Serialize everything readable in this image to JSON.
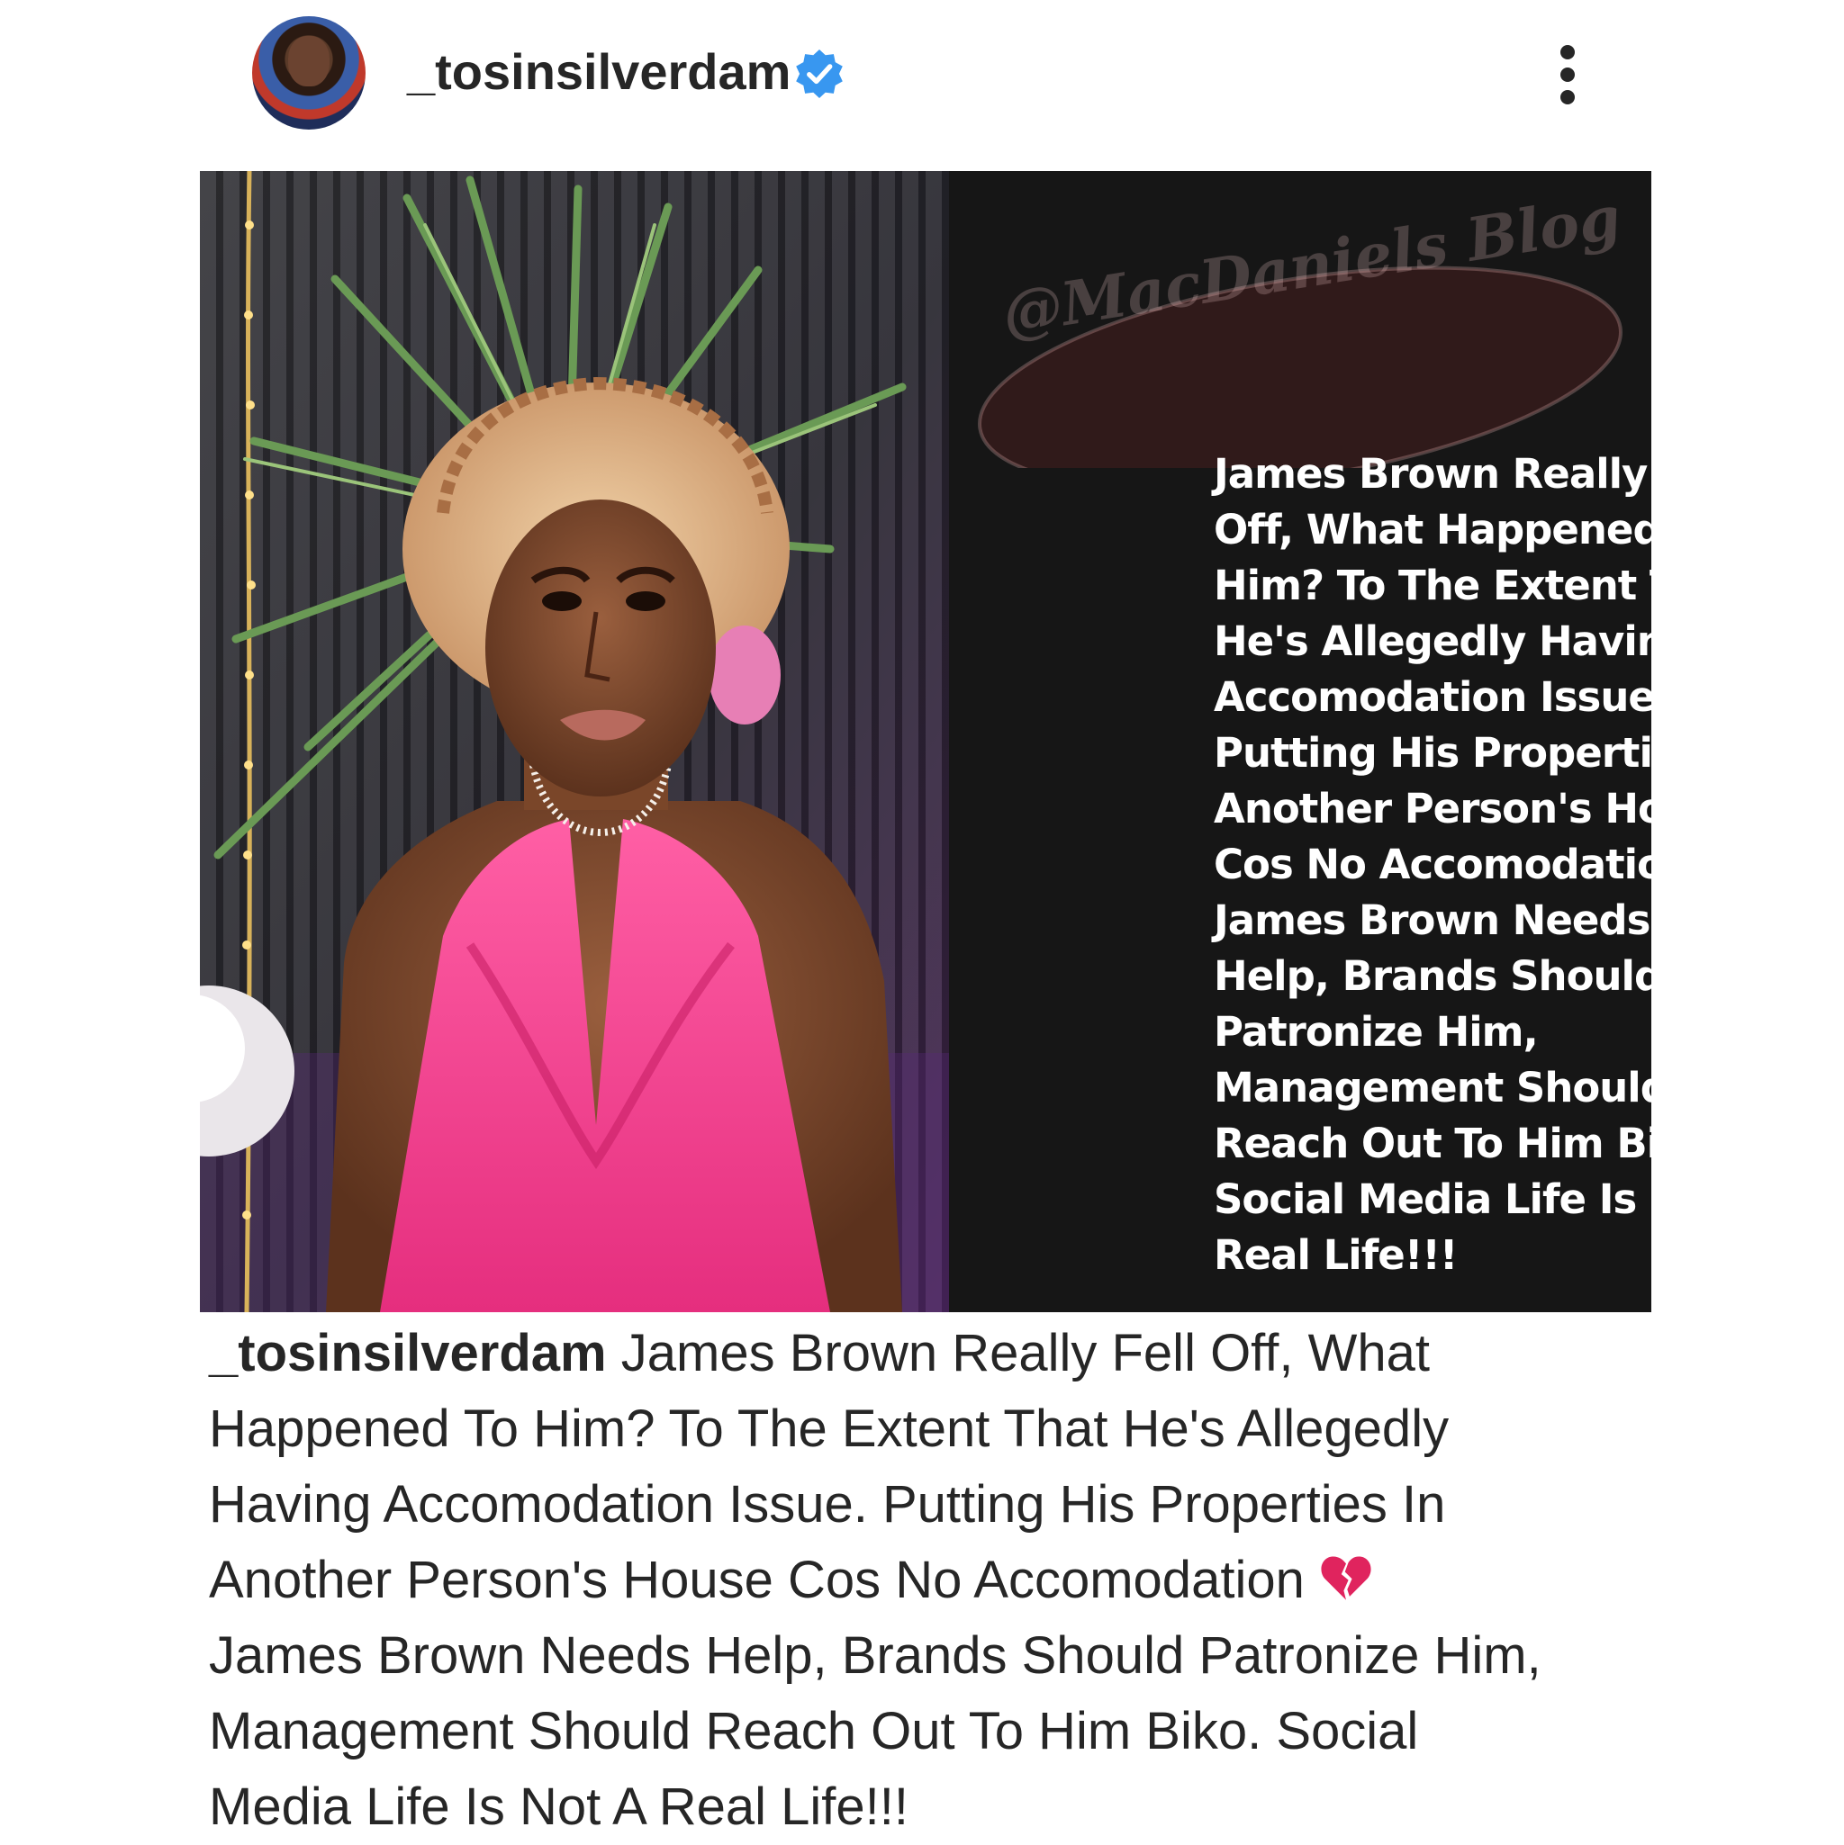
{
  "post": {
    "username": "_tosinsilverdam",
    "verified": true,
    "image": {
      "watermark": "@MacDaniels Blog",
      "headline_lines": [
        "James Brown Really Fell",
        "Off, What Happened To",
        "Him? To The Extent That",
        "He's Allegedly Having",
        "Accomodation Issue.",
        "Putting His Properties In",
        "Another Person's House",
        "Cos No Accomodation",
        "James Brown Needs",
        "Help, Brands Should",
        "Patronize Him,",
        "Management Should",
        "Reach Out To Him Biko.",
        "Social Media Life Is Not A",
        "Real Life!!!"
      ]
    },
    "caption": {
      "username": "_tosinsilverdam",
      "line1_rest": " James Brown Really Fell Off, What",
      "line2": "Happened To Him? To The Extent That He's Allegedly",
      "line3": "Having Accomodation Issue. Putting His Properties In",
      "line4": "Another Person's House Cos No Accomodation ",
      "line5": "James Brown Needs Help, Brands Should Patronize Him,",
      "line6": "Management Should Reach Out To Him Biko. Social",
      "line7": "Media Life Is Not A Real Life!!!"
    }
  },
  "icons": {
    "verified": "verified-badge-icon",
    "more": "more-options-icon",
    "broken_heart": "broken-heart-icon"
  },
  "colors": {
    "verified_blue": "#3897f0",
    "text": "#262626",
    "panel_bg": "#161616",
    "broken_heart": "#e0245e"
  }
}
